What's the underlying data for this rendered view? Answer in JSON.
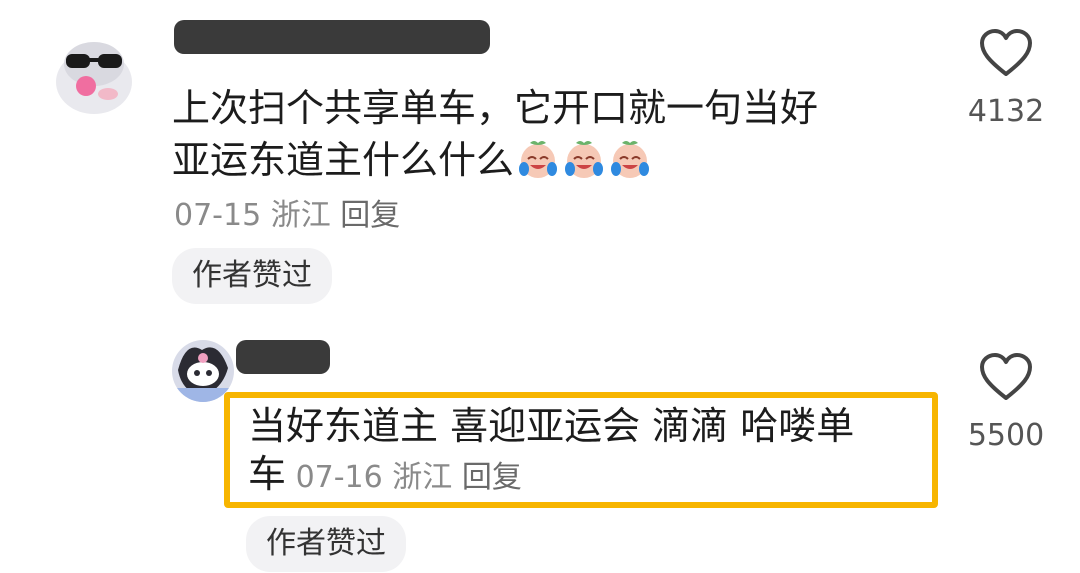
{
  "comments": [
    {
      "text_line1": "上次扫个共享单车，它开口就一句当好",
      "text_line2": "亚运东道主什么什么",
      "emoji": [
        "crying-laugh-emoji",
        "crying-laugh-emoji",
        "crying-laugh-emoji"
      ],
      "date": "07-15",
      "location": "浙江",
      "reply_label": "回复",
      "badge": "作者赞过",
      "like_count": "4132"
    },
    {
      "text_line1": "当好东道主 喜迎亚运会 滴滴 哈喽单",
      "text_line2": "车",
      "date": "07-16",
      "location": "浙江",
      "reply_label": "回复",
      "badge": "作者赞过",
      "like_count": "5500"
    }
  ],
  "colors": {
    "highlight": "#f7b500",
    "meta": "#8a8a8a",
    "text": "#1c1c1c"
  }
}
